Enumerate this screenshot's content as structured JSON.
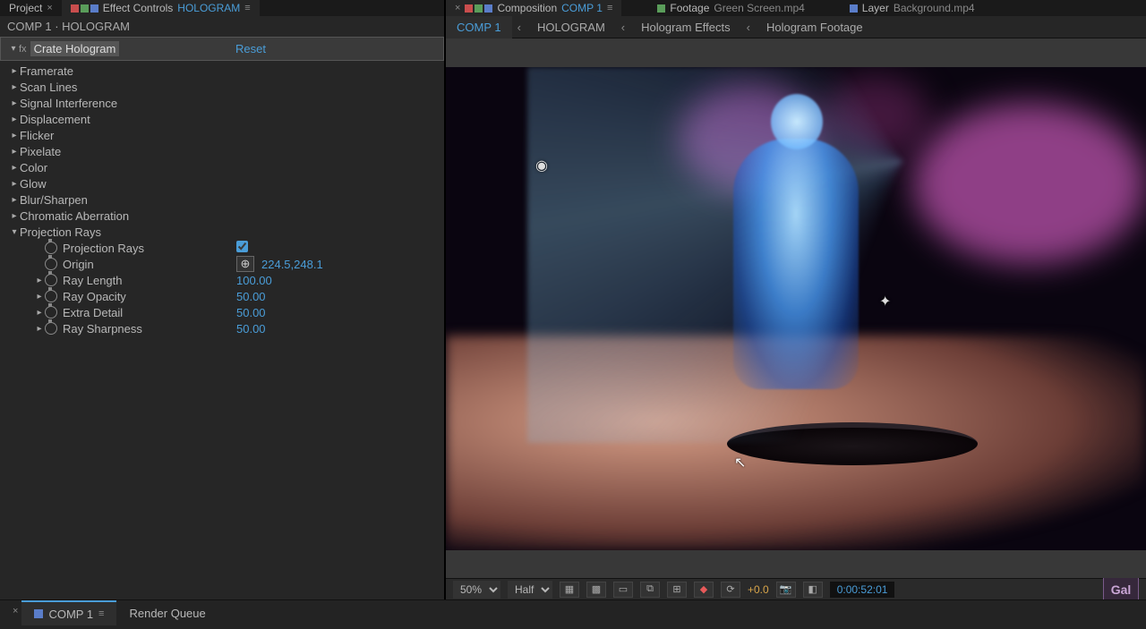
{
  "left_tabs": {
    "project": "Project",
    "effect_controls": "Effect Controls",
    "effect_controls_target": "HOLOGRAM"
  },
  "breadcrumb": "COMP 1 · HOLOGRAM",
  "effect": {
    "name": "Crate Hologram",
    "reset": "Reset",
    "groups": {
      "framerate": "Framerate",
      "scan_lines": "Scan Lines",
      "signal_interference": "Signal Interference",
      "displacement": "Displacement",
      "flicker": "Flicker",
      "pixelate": "Pixelate",
      "color": "Color",
      "glow": "Glow",
      "blur_sharpen": "Blur/Sharpen",
      "chromatic_aberration": "Chromatic Aberration",
      "projection_rays": "Projection Rays"
    },
    "props": {
      "projection_rays_toggle": "Projection Rays",
      "origin": "Origin",
      "origin_value": "224.5,248.1",
      "ray_length": "Ray Length",
      "ray_length_value": "100.00",
      "ray_opacity": "Ray Opacity",
      "ray_opacity_value": "50.00",
      "extra_detail": "Extra Detail",
      "extra_detail_value": "50.00",
      "ray_sharpness": "Ray Sharpness",
      "ray_sharpness_value": "50.00"
    }
  },
  "right_tabs": {
    "composition": "Composition",
    "composition_target": "COMP 1",
    "footage": "Footage",
    "footage_target": "Green Screen.mp4",
    "layer": "Layer",
    "layer_target": "Background.mp4"
  },
  "comp_nav": {
    "comp1": "COMP 1",
    "hologram": "HOLOGRAM",
    "hologram_effects": "Hologram Effects",
    "hologram_footage": "Hologram Footage"
  },
  "viewer": {
    "zoom": "50%",
    "resolution": "Half",
    "exposure": "+0.0",
    "timecode": "0:00:52:01"
  },
  "bottom": {
    "comp1": "COMP 1",
    "render_queue": "Render Queue"
  },
  "badge": "Gal"
}
